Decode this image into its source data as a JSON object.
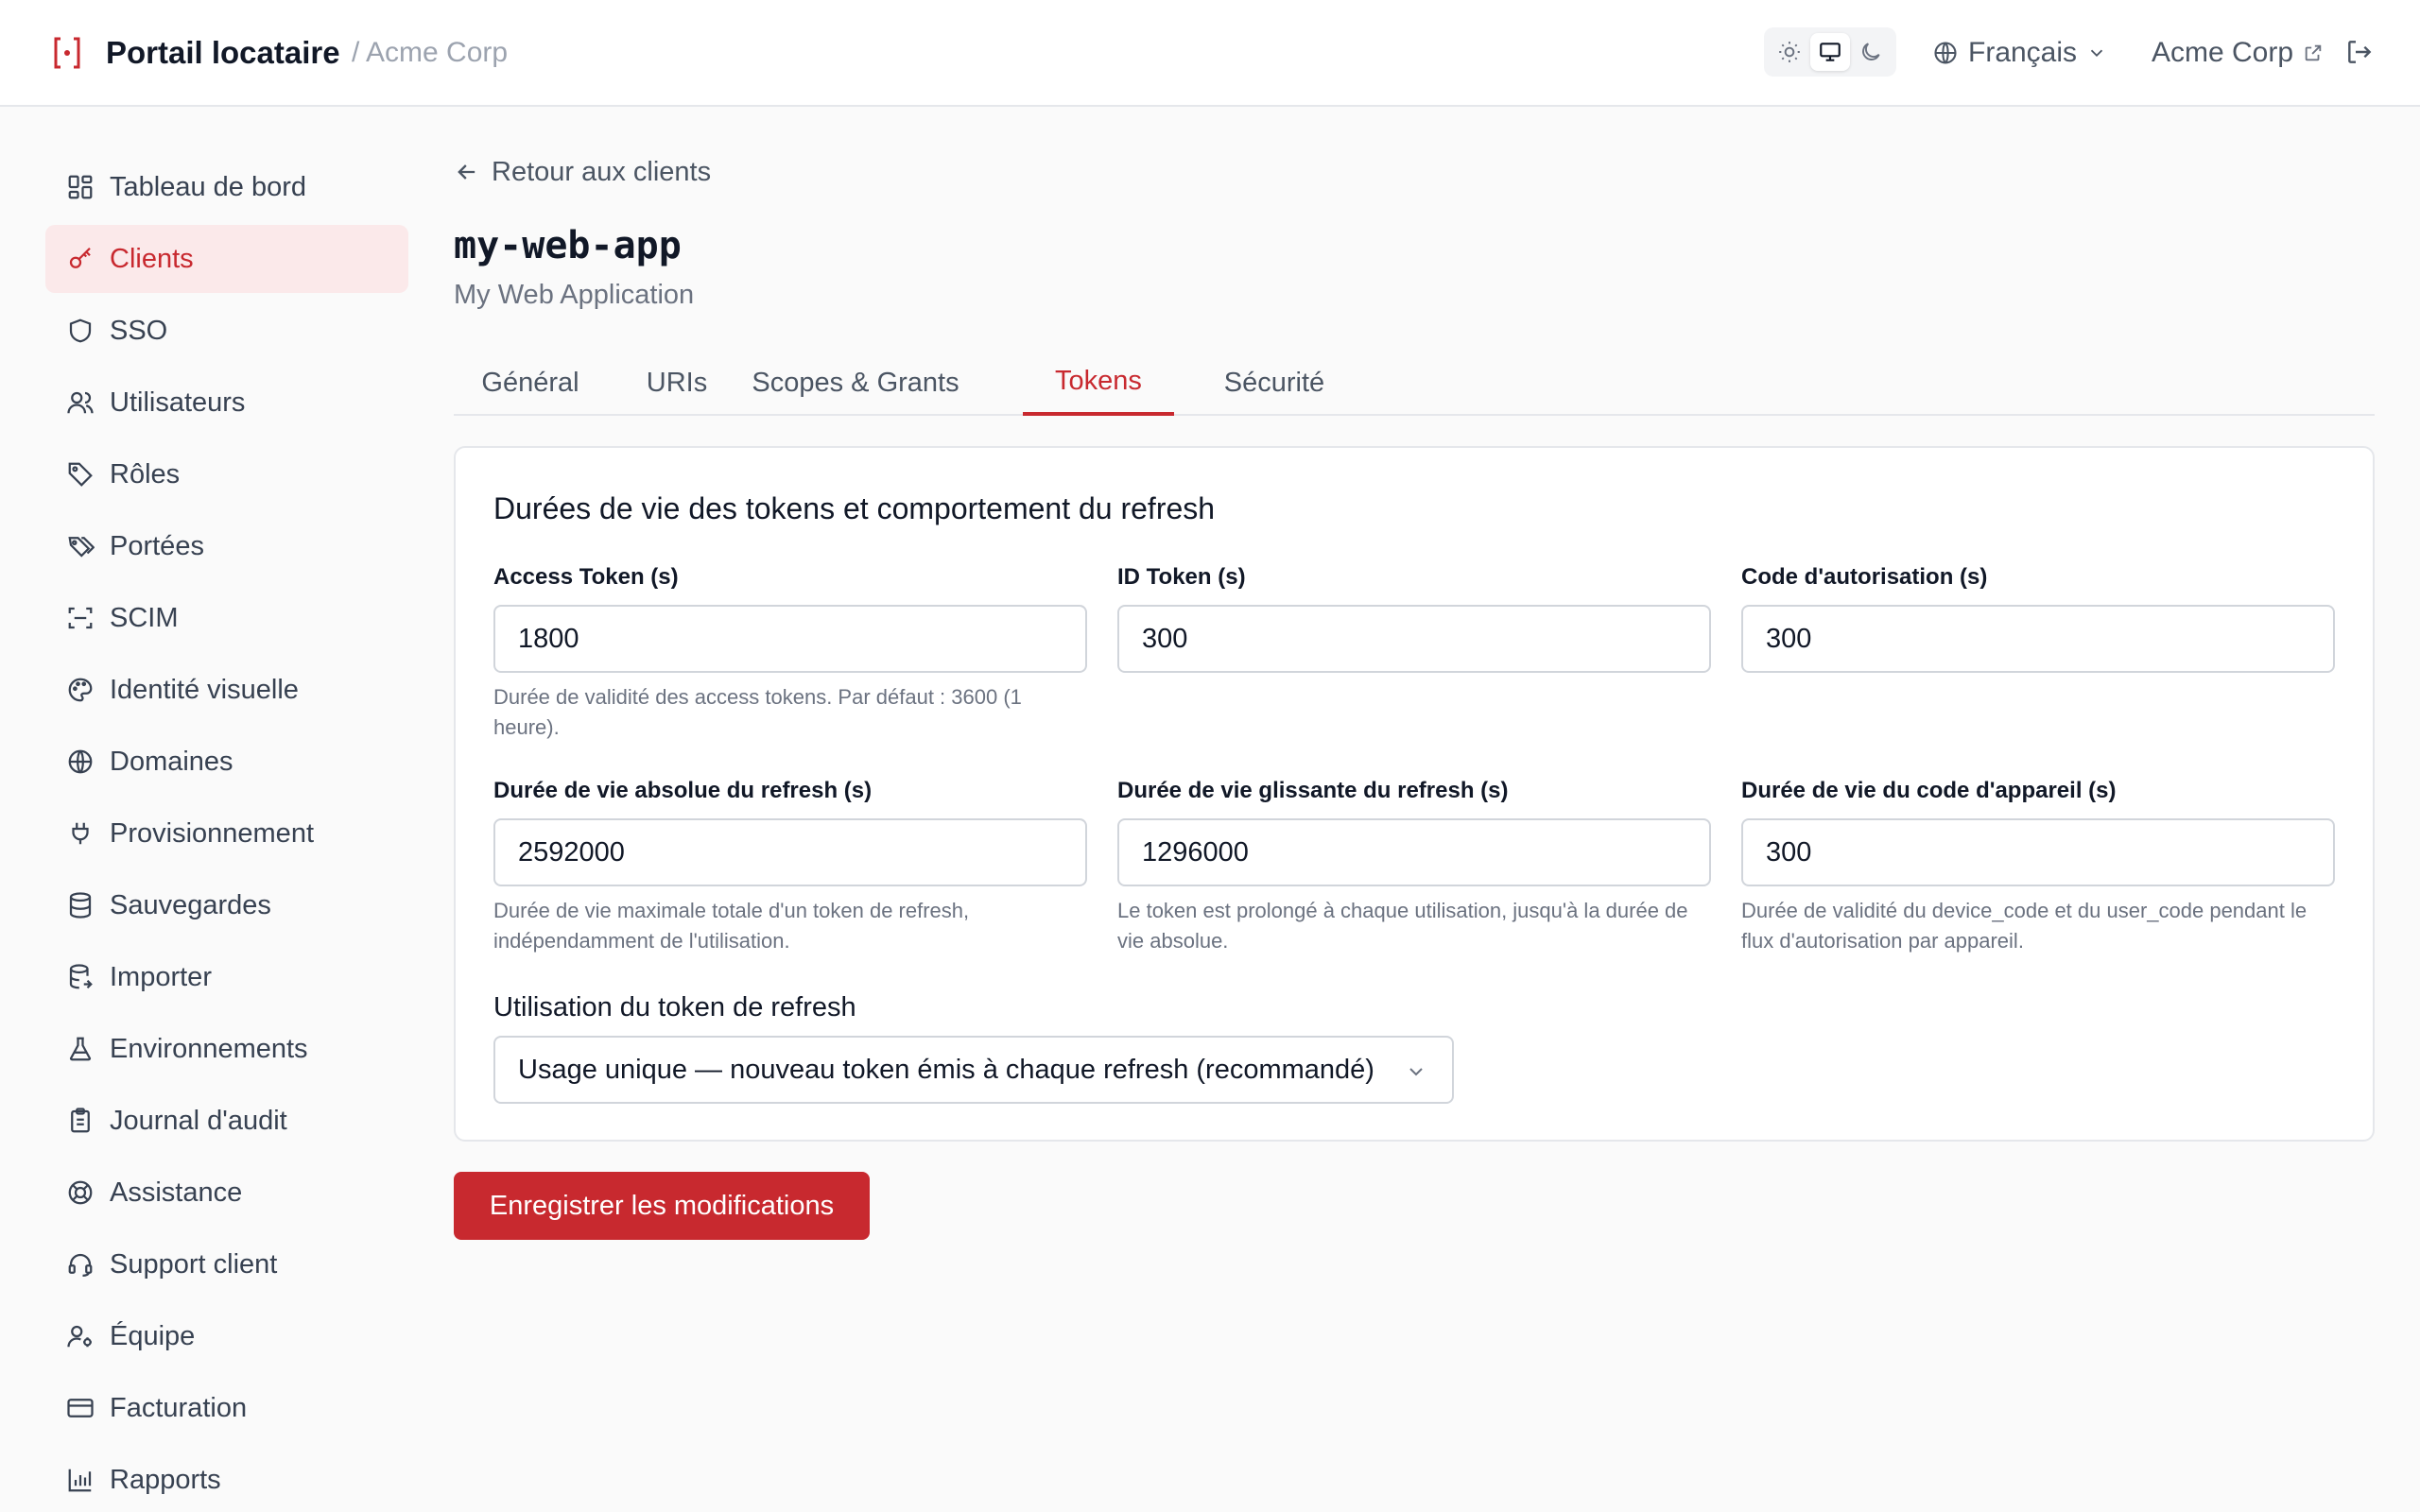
{
  "header": {
    "brand": "Portail locataire",
    "tenant_crumb": "/ Acme Corp",
    "language": "Français",
    "org_link": "Acme Corp",
    "theme_options": [
      "sun-icon",
      "monitor-icon",
      "moon-icon"
    ],
    "active_theme": "monitor-icon"
  },
  "sidebar": {
    "items": [
      {
        "label": "Tableau de bord",
        "icon": "dashboard-icon"
      },
      {
        "label": "Clients",
        "icon": "key-icon",
        "active": true
      },
      {
        "label": "SSO",
        "icon": "shield-icon"
      },
      {
        "label": "Utilisateurs",
        "icon": "users-icon"
      },
      {
        "label": "Rôles",
        "icon": "tag-icon"
      },
      {
        "label": "Portées",
        "icon": "tags-icon"
      },
      {
        "label": "SCIM",
        "icon": "scan-icon"
      },
      {
        "label": "Identité visuelle",
        "icon": "palette-icon"
      },
      {
        "label": "Domaines",
        "icon": "globe-icon"
      },
      {
        "label": "Provisionnement",
        "icon": "plug-icon"
      },
      {
        "label": "Sauvegardes",
        "icon": "database-icon"
      },
      {
        "label": "Importer",
        "icon": "database-import-icon"
      },
      {
        "label": "Environnements",
        "icon": "flask-icon"
      },
      {
        "label": "Journal d'audit",
        "icon": "clipboard-icon"
      },
      {
        "label": "Assistance",
        "icon": "lifebuoy-icon"
      },
      {
        "label": "Support client",
        "icon": "headset-icon"
      },
      {
        "label": "Équipe",
        "icon": "user-cog-icon"
      },
      {
        "label": "Facturation",
        "icon": "credit-card-icon"
      },
      {
        "label": "Rapports",
        "icon": "bar-chart-icon"
      }
    ]
  },
  "main": {
    "back_link": "Retour aux clients",
    "client_id": "my-web-app",
    "client_name": "My Web Application",
    "tabs": [
      {
        "label": "Général"
      },
      {
        "label": "URIs"
      },
      {
        "label": "Scopes & Grants"
      },
      {
        "label": "Tokens",
        "active": true
      },
      {
        "label": "Sécurité"
      }
    ],
    "card": {
      "title": "Durées de vie des tokens et comportement du refresh",
      "fields": [
        {
          "label": "Access Token (s)",
          "value": "1800",
          "help": "Durée de validité des access tokens. Par défaut : 3600 (1 heure)."
        },
        {
          "label": "ID Token (s)",
          "value": "300",
          "help": ""
        },
        {
          "label": "Code d'autorisation (s)",
          "value": "300",
          "help": ""
        },
        {
          "label": "Durée de vie absolue du refresh (s)",
          "value": "2592000",
          "help": "Durée de vie maximale totale d'un token de refresh, indépendamment de l'utilisation."
        },
        {
          "label": "Durée de vie glissante du refresh (s)",
          "value": "1296000",
          "help": "Le token est prolongé à chaque utilisation, jusqu'à la durée de vie absolue."
        },
        {
          "label": "Durée de vie du code d'appareil (s)",
          "value": "300",
          "help": "Durée de validité du device_code et du user_code pendant le flux d'autorisation par appareil."
        }
      ],
      "refresh_usage_label": "Utilisation du token de refresh",
      "refresh_usage_value": "Usage unique — nouveau token émis à chaque refresh (recommandé)"
    },
    "save_button": "Enregistrer les modifications"
  },
  "colors": {
    "accent": "#c8292f",
    "active_nav_bg": "#fbe9ea"
  }
}
